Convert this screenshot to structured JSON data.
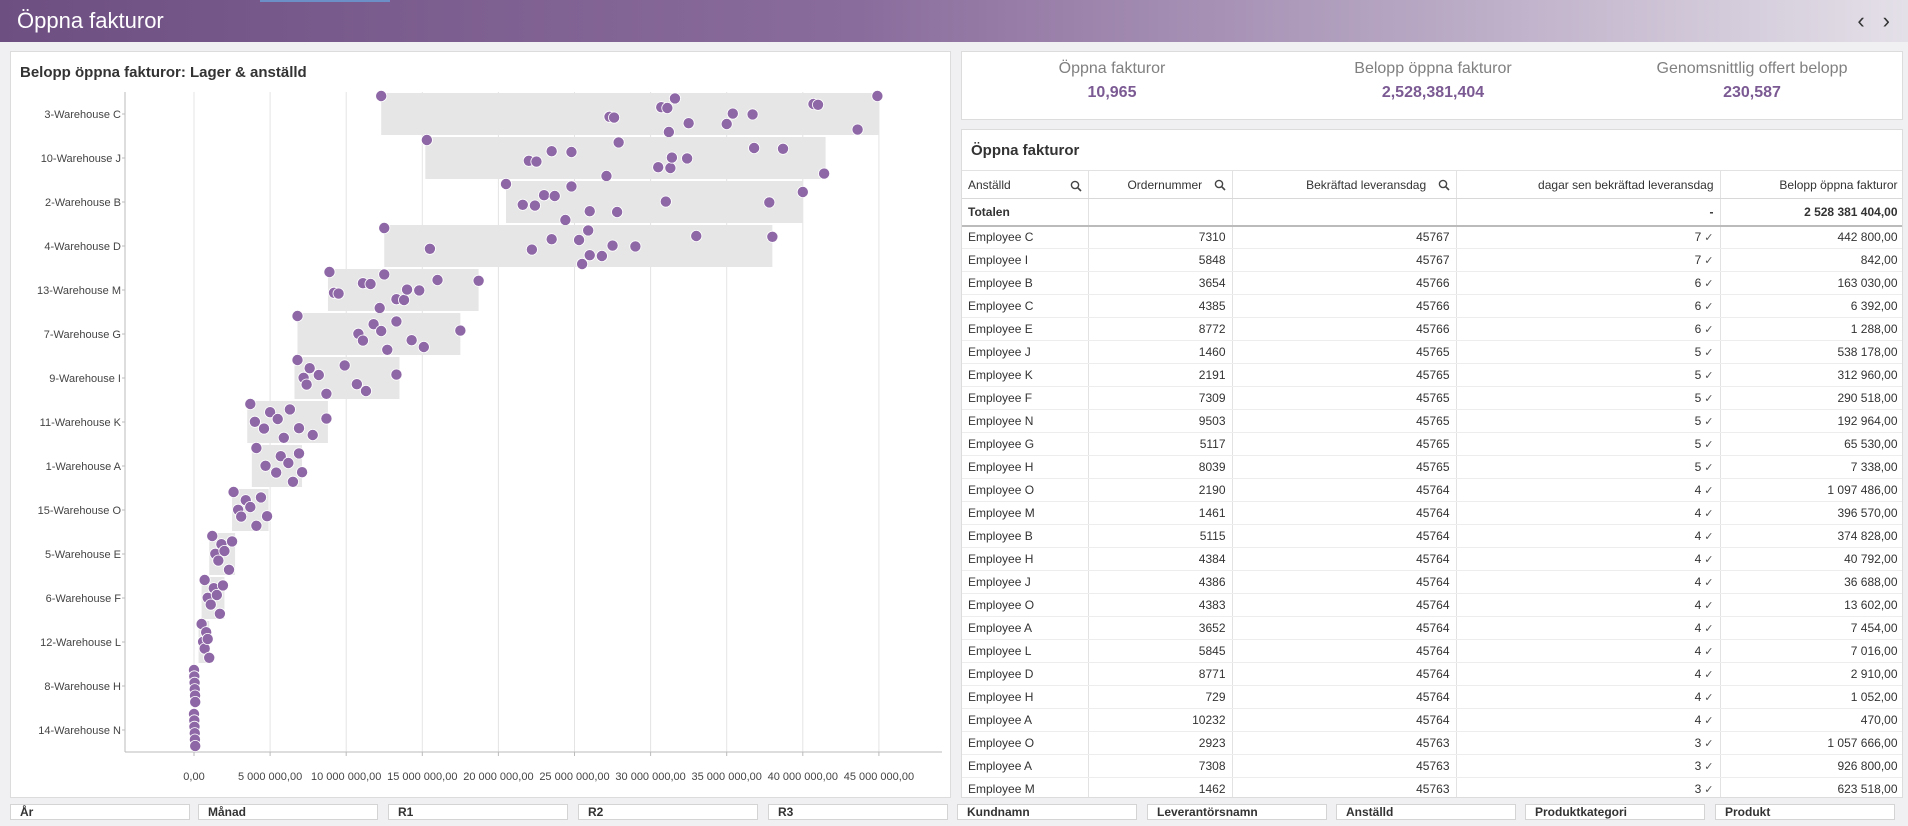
{
  "header": {
    "title": "Öppna fakturor",
    "prev_icon": "chevron-left-icon",
    "next_icon": "chevron-right-icon"
  },
  "chart": {
    "title": "Belopp öppna fakturor: Lager & anställd",
    "colors": {
      "point": "#8e67a6",
      "band": "#e6e6e6"
    }
  },
  "kpis": [
    {
      "label": "Öppna fakturor",
      "value": "10,965"
    },
    {
      "label": "Belopp öppna fakturor",
      "value": "2,528,381,404"
    },
    {
      "label": "Genomsnittlig offert belopp",
      "value": "230,587"
    }
  ],
  "table": {
    "title": "Öppna fakturor",
    "columns": [
      "Anställd",
      "Ordernummer",
      "Bekräftad leveransdag",
      "dagar sen bekräftad leveransdag",
      "Belopp öppna fakturor"
    ],
    "totals": {
      "label": "Totalen",
      "days": "-",
      "amount": "2 528 381 404,00"
    },
    "rows": [
      [
        "Employee C",
        "7310",
        "45767",
        "7",
        "442 800,00"
      ],
      [
        "Employee I",
        "5848",
        "45767",
        "7",
        "842,00"
      ],
      [
        "Employee B",
        "3654",
        "45766",
        "6",
        "163 030,00"
      ],
      [
        "Employee C",
        "4385",
        "45766",
        "6",
        "6 392,00"
      ],
      [
        "Employee E",
        "8772",
        "45766",
        "6",
        "1 288,00"
      ],
      [
        "Employee J",
        "1460",
        "45765",
        "5",
        "538 178,00"
      ],
      [
        "Employee K",
        "2191",
        "45765",
        "5",
        "312 960,00"
      ],
      [
        "Employee F",
        "7309",
        "45765",
        "5",
        "290 518,00"
      ],
      [
        "Employee N",
        "9503",
        "45765",
        "5",
        "192 964,00"
      ],
      [
        "Employee G",
        "5117",
        "45765",
        "5",
        "65 530,00"
      ],
      [
        "Employee H",
        "8039",
        "45765",
        "5",
        "7 338,00"
      ],
      [
        "Employee O",
        "2190",
        "45764",
        "4",
        "1 097 486,00"
      ],
      [
        "Employee M",
        "1461",
        "45764",
        "4",
        "396 570,00"
      ],
      [
        "Employee B",
        "5115",
        "45764",
        "4",
        "374 828,00"
      ],
      [
        "Employee H",
        "4384",
        "45764",
        "4",
        "40 792,00"
      ],
      [
        "Employee J",
        "4386",
        "45764",
        "4",
        "36 688,00"
      ],
      [
        "Employee O",
        "4383",
        "45764",
        "4",
        "13 602,00"
      ],
      [
        "Employee A",
        "3652",
        "45764",
        "4",
        "7 454,00"
      ],
      [
        "Employee L",
        "5845",
        "45764",
        "4",
        "7 016,00"
      ],
      [
        "Employee D",
        "8771",
        "45764",
        "4",
        "2 910,00"
      ],
      [
        "Employee H",
        "729",
        "45764",
        "4",
        "1 052,00"
      ],
      [
        "Employee A",
        "10232",
        "45764",
        "4",
        "470,00"
      ],
      [
        "Employee O",
        "2923",
        "45763",
        "3",
        "1 057 666,00"
      ],
      [
        "Employee A",
        "7308",
        "45763",
        "3",
        "926 800,00"
      ],
      [
        "Employee M",
        "1462",
        "45763",
        "3",
        "623 518,00"
      ]
    ]
  },
  "filters": [
    "År",
    "Månad",
    "R1",
    "R2",
    "R3",
    "Kundnamn",
    "Leverantörsnamn",
    "Anställd",
    "Produktkategori",
    "Produkt"
  ],
  "chart_data": {
    "type": "scatter",
    "title": "Belopp öppna fakturor: Lager & anställd",
    "xlim": [
      0,
      47000000
    ],
    "xticks": [
      "0,00",
      "5 000 000,00",
      "10 000 000,00",
      "15 000 000,00",
      "20 000 000,00",
      "25 000 000,00",
      "30 000 000,00",
      "35 000 000,00",
      "40 000 000,00",
      "45 000 000,00"
    ],
    "categories": [
      "3-Warehouse C",
      "10-Warehouse J",
      "2-Warehouse B",
      "4-Warehouse D",
      "13-Warehouse M",
      "7-Warehouse G",
      "9-Warehouse I",
      "11-Warehouse K",
      "1-Warehouse A",
      "15-Warehouse O",
      "5-Warehouse E",
      "6-Warehouse F",
      "12-Warehouse L",
      "8-Warehouse H",
      "14-Warehouse N"
    ],
    "ranges": [
      [
        12300000,
        45000000
      ],
      [
        15200000,
        41500000
      ],
      [
        20500000,
        40000000
      ],
      [
        12500000,
        38000000
      ],
      [
        8800000,
        18700000
      ],
      [
        6800000,
        17500000
      ],
      [
        6600000,
        13500000
      ],
      [
        3500000,
        8800000
      ],
      [
        3800000,
        7100000
      ],
      [
        2500000,
        4900000
      ],
      [
        1000000,
        2700000
      ],
      [
        500000,
        2000000
      ],
      [
        300000,
        1000000
      ],
      [
        0,
        150000
      ],
      [
        0,
        120000
      ]
    ],
    "points": [
      [
        12.3,
        27.3,
        27.6,
        30.7,
        31.1,
        31.2,
        31.6,
        32.5,
        35.0,
        35.4,
        36.7,
        40.7,
        41.0,
        43.6,
        44.9
      ],
      [
        15.3,
        22.0,
        22.5,
        23.5,
        24.8,
        27.1,
        27.9,
        30.5,
        31.3,
        31.4,
        32.4,
        36.8,
        38.7,
        41.4
      ],
      [
        20.5,
        21.6,
        22.4,
        23.0,
        23.7,
        24.4,
        24.8,
        26.0,
        27.8,
        31.0,
        37.8,
        40.0
      ],
      [
        12.5,
        15.5,
        22.2,
        23.5,
        25.3,
        25.5,
        25.9,
        26.0,
        26.8,
        27.5,
        29.0,
        33.0,
        38.0
      ],
      [
        8.9,
        9.2,
        9.5,
        11.1,
        11.6,
        12.2,
        12.5,
        13.3,
        13.8,
        14.0,
        14.8,
        16.0,
        18.7
      ],
      [
        6.8,
        10.8,
        11.1,
        11.8,
        12.3,
        12.7,
        13.3,
        14.3,
        15.1,
        17.5
      ],
      [
        6.8,
        7.2,
        7.4,
        7.6,
        8.2,
        8.7,
        9.9,
        10.7,
        11.3,
        13.3
      ],
      [
        3.7,
        4.0,
        4.6,
        5.0,
        5.5,
        5.9,
        6.3,
        6.9,
        7.8,
        8.7
      ],
      [
        4.1,
        4.7,
        5.4,
        5.7,
        6.2,
        6.5,
        6.9,
        7.1
      ],
      [
        2.6,
        2.9,
        3.1,
        3.4,
        3.7,
        4.1,
        4.4,
        4.8
      ],
      [
        1.2,
        1.4,
        1.6,
        1.8,
        2.0,
        2.3,
        2.5
      ],
      [
        0.7,
        0.9,
        1.1,
        1.3,
        1.5,
        1.7,
        1.9
      ],
      [
        0.5,
        0.6,
        0.7,
        0.8,
        0.9,
        1.0
      ],
      [
        0.0,
        0.02,
        0.04,
        0.05,
        0.07,
        0.08
      ],
      [
        0.0,
        0.02,
        0.03,
        0.05,
        0.06,
        0.08
      ]
    ],
    "grid": true
  }
}
